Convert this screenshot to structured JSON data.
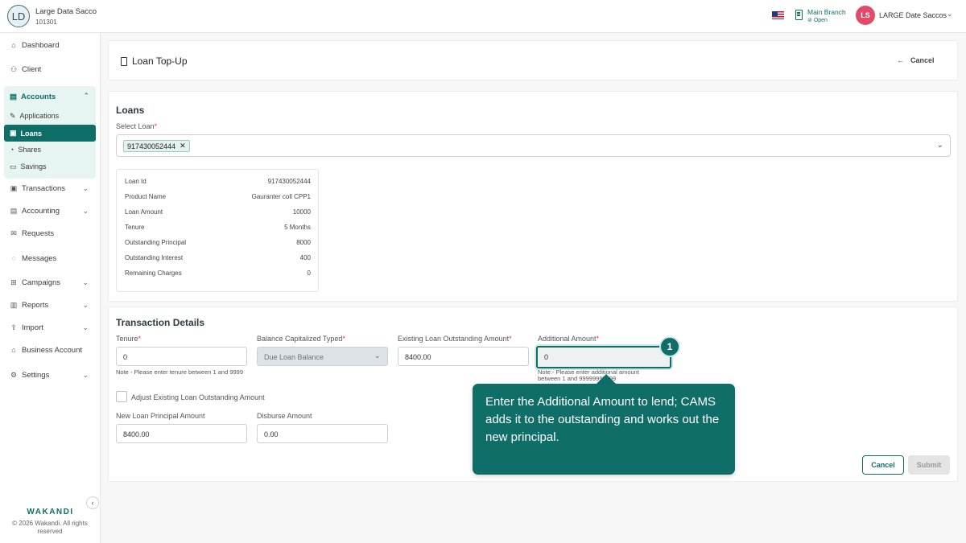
{
  "org": {
    "initials": "LD",
    "name": "Large Data Sacco",
    "code": "101301"
  },
  "header": {
    "branch_name": "Main Branch",
    "branch_status": "Open",
    "user_initials": "LS",
    "user_name": "LARGE Date Saccos"
  },
  "sidebar": {
    "dashboard": "Dashboard",
    "client": "Client",
    "accounts": "Accounts",
    "applications": "Applications",
    "loans": "Loans",
    "shares": "Shares",
    "savings": "Savings",
    "transactions": "Transactions",
    "accounting": "Accounting",
    "requests": "Requests",
    "messages": "Messages",
    "campaigns": "Campaigns",
    "reports": "Reports",
    "import": "Import",
    "business_account": "Business Account",
    "settings": "Settings",
    "brand": "WAKANDI",
    "copyright": "© 2026 Wakandi. All rights reserved"
  },
  "page": {
    "title": "Loan Top-Up",
    "cancel": "Cancel"
  },
  "loans_section": {
    "title": "Loans",
    "select_label": "Select Loan",
    "selected_loan": "917430052444",
    "info": [
      {
        "label": "Loan Id",
        "value": "917430052444"
      },
      {
        "label": "Product Name",
        "value": "Gauranter coll CPP1"
      },
      {
        "label": "Loan Amount",
        "value": "10000"
      },
      {
        "label": "Tenure",
        "value": "5 Months"
      },
      {
        "label": "Outstanding Principal",
        "value": "8000"
      },
      {
        "label": "Outstanding Interest",
        "value": "400"
      },
      {
        "label": "Remaining Charges",
        "value": "0"
      }
    ]
  },
  "transaction": {
    "title": "Transaction Details",
    "tenure_label": "Tenure",
    "tenure_value": "0",
    "tenure_note": "Note - Please enter tenure between 1 and 9999",
    "balance_type_label": "Balance Capitalized Typed",
    "balance_type_value": "Due Loan Balance",
    "existing_label": "Existing Loan Outstanding Amount",
    "existing_value": "8400.00",
    "additional_label": "Additional Amount",
    "additional_value": "0",
    "additional_note": "Note:- Please enter additional amount between 1 and 99999999999",
    "adjust_label": "Adjust Existing Loan Outstanding Amount",
    "new_principal_label": "New Loan Principal Amount",
    "new_principal_value": "8400.00",
    "disburse_label": "Disburse Amount",
    "disburse_value": "0.00",
    "cancel_btn": "Cancel",
    "submit_btn": "Submit"
  },
  "tour": {
    "step": "1",
    "text": "Enter the Additional Amount to lend; CAMS adds it to the outstanding and works out the new principal."
  }
}
